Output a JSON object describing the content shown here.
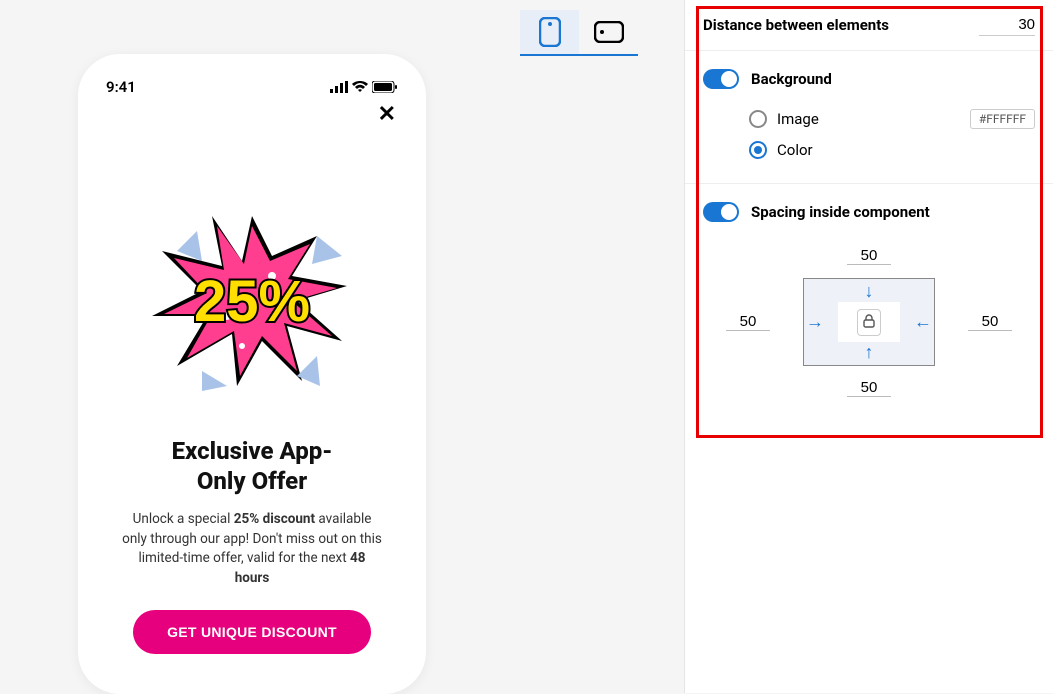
{
  "preview": {
    "statusbar": {
      "time": "9:41"
    },
    "close_label": "✕",
    "promo": {
      "percent": "25%",
      "title_line1": "Exclusive App-",
      "title_line2": "Only Offer",
      "desc_pre": "Unlock a special ",
      "desc_bold": "25% discount",
      "desc_post": " available only through our app! Don't miss out on this limited-time offer, valid for the next ",
      "desc_bold2": "48 hours",
      "cta": "GET UNIQUE DISCOUNT"
    }
  },
  "panel": {
    "distance": {
      "label": "Distance between elements",
      "value": "30"
    },
    "background": {
      "title": "Background",
      "options": {
        "image": "Image",
        "color": "Color"
      },
      "selected": "color",
      "color_value": "#FFFFFF"
    },
    "spacing": {
      "title": "Spacing inside component",
      "top": "50",
      "right": "50",
      "bottom": "50",
      "left": "50"
    }
  }
}
